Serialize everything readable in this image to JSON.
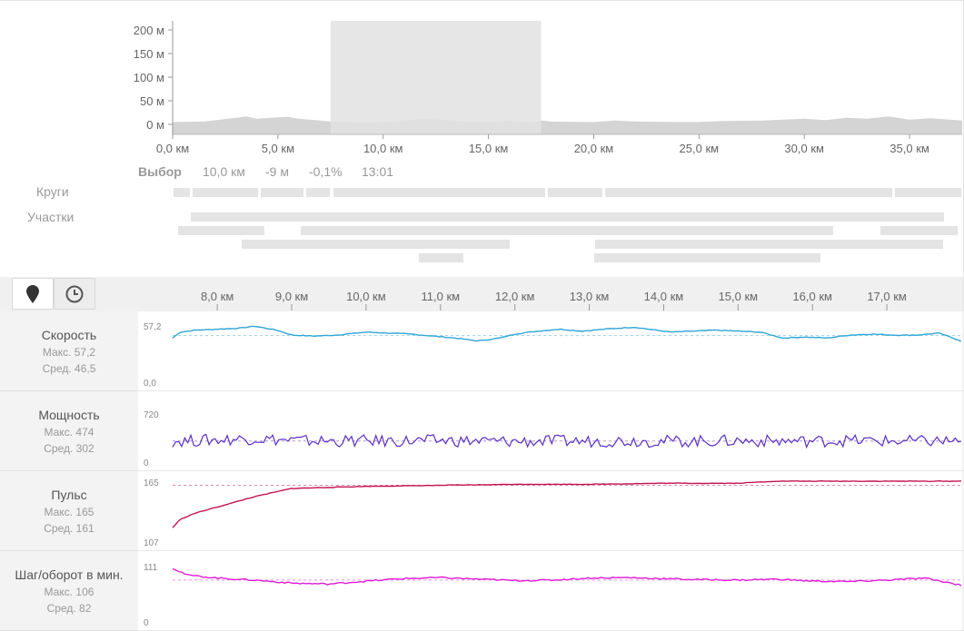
{
  "elevation": {
    "y_ticks": [
      "200 м",
      "150 м",
      "100 м",
      "50 м",
      "0 м"
    ],
    "x_ticks": [
      "0,0 км",
      "5,0 км",
      "10,0 км",
      "15,0 км",
      "20,0 км",
      "25,0 км",
      "30,0 км",
      "35,0 км"
    ],
    "selection_km": [
      7.5,
      17.5
    ]
  },
  "selection": {
    "label": "Выбор",
    "distance": "10,0 км",
    "elevation": "-9 м",
    "grade": "-0,1%",
    "time": "13:01"
  },
  "rows": {
    "laps_label": "Круги",
    "segments_label": "Участки"
  },
  "toolbar": {
    "distance_icon": "map-pin-icon",
    "time_icon": "clock-icon"
  },
  "zoom_axis": {
    "x_ticks": [
      "8,0 км",
      "9,0 км",
      "10,0 км",
      "11,0 км",
      "12,0 км",
      "13,0 км",
      "14,0 км",
      "15,0 км",
      "16,0 км",
      "17,0 км"
    ]
  },
  "streams": [
    {
      "name": "Скорость",
      "max": "Макс. 57,2",
      "avg": "Сред. 46,5",
      "top_label": "57,2",
      "bottom_label": "0,0",
      "color": "#2fa6d6"
    },
    {
      "name": "Мощность",
      "max": "Макс. 474",
      "avg": "Сред. 302",
      "top_label": "720",
      "bottom_label": "0",
      "color": "#5c2fc2"
    },
    {
      "name": "Пульс",
      "max": "Макс. 165",
      "avg": "Сред. 161",
      "top_label": "165",
      "bottom_label": "107",
      "color": "#c4134f"
    },
    {
      "name": "Шаг/оборот в мин.",
      "max": "Макс. 106",
      "avg": "Сред. 82",
      "top_label": "111",
      "bottom_label": "0",
      "color": "#e01ad6"
    }
  ],
  "chart_data": [
    {
      "type": "area",
      "ylim": [
        0,
        200
      ],
      "xlim": [
        0,
        37.5
      ],
      "x": [
        0,
        1.5,
        3,
        3.5,
        4,
        5,
        5.5,
        6,
        7,
        7.5,
        9,
        10,
        11,
        12,
        13,
        14,
        15,
        16,
        17,
        17.5,
        18,
        20,
        21,
        22,
        24,
        25,
        26,
        28,
        29,
        30,
        31,
        32,
        33,
        34,
        35,
        36,
        37.5
      ],
      "y": [
        5,
        6,
        14,
        17,
        12,
        15,
        16,
        12,
        8,
        6,
        4,
        5,
        8,
        12,
        9,
        6,
        5,
        8,
        4,
        8,
        6,
        5,
        8,
        6,
        5,
        5,
        7,
        8,
        10,
        12,
        9,
        14,
        12,
        17,
        10,
        13,
        8
      ],
      "yunit": "м"
    },
    {
      "type": "line",
      "name": "Скорость",
      "xlim": [
        7.4,
        18.0
      ],
      "ylim": [
        0,
        57.2
      ],
      "avg": 46.5,
      "x": [
        7.4,
        7.5,
        7.7,
        8.0,
        8.3,
        8.5,
        8.8,
        9.0,
        9.3,
        9.6,
        10.0,
        10.3,
        10.6,
        10.9,
        11.2,
        11.5,
        11.8,
        12.0,
        12.3,
        12.6,
        12.9,
        13.2,
        13.6,
        13.9,
        14.1,
        14.4,
        14.7,
        15.0,
        15.3,
        15.6,
        15.9,
        16.2,
        16.5,
        16.8,
        17.1,
        17.4,
        17.7,
        18.0
      ],
      "y": [
        44,
        50,
        52,
        53,
        54,
        56,
        52,
        47,
        46,
        47,
        50,
        49,
        48,
        46,
        44,
        41,
        44,
        48,
        51,
        53,
        51,
        53,
        55,
        52,
        50,
        51,
        52,
        51,
        50,
        44,
        45,
        44,
        47,
        48,
        47,
        47,
        49,
        41
      ]
    },
    {
      "type": "line",
      "name": "Мощность",
      "xlim": [
        7.4,
        18.0
      ],
      "ylim": [
        0,
        720
      ],
      "avg": 302,
      "x": [
        7.4,
        8.0,
        8.5,
        9.0,
        9.5,
        10.0,
        10.5,
        11.0,
        11.5,
        12.0,
        12.5,
        13.0,
        13.5,
        14.0,
        14.5,
        15.0,
        15.5,
        16.0,
        16.5,
        17.0,
        17.5,
        18.0
      ],
      "y": [
        300,
        320,
        340,
        310,
        300,
        305,
        300,
        310,
        300,
        295,
        300,
        300,
        305,
        300,
        300,
        305,
        300,
        300,
        310,
        300,
        300,
        305
      ]
    },
    {
      "type": "line",
      "name": "Пульс",
      "xlim": [
        7.4,
        18.0
      ],
      "ylim": [
        107,
        165
      ],
      "avg": 161,
      "x": [
        7.4,
        7.5,
        7.7,
        8.0,
        8.5,
        9.0,
        10.0,
        11.0,
        12.0,
        13.0,
        14.0,
        15.0,
        15.5,
        16.0,
        17.0,
        18.0
      ],
      "y": [
        120,
        128,
        134,
        140,
        150,
        158,
        160,
        161,
        162,
        162,
        163,
        163,
        165,
        165,
        165,
        165
      ]
    },
    {
      "type": "line",
      "name": "Шаг/оборот в мин.",
      "xlim": [
        7.4,
        18.0
      ],
      "ylim": [
        0,
        111
      ],
      "avg": 82,
      "x": [
        7.4,
        7.6,
        8.0,
        8.5,
        9.0,
        9.5,
        10.0,
        10.5,
        11.0,
        11.5,
        12.0,
        12.5,
        13.0,
        13.5,
        14.0,
        14.5,
        15.0,
        15.5,
        16.0,
        16.5,
        17.0,
        17.5,
        18.0
      ],
      "y": [
        106,
        92,
        86,
        82,
        76,
        74,
        80,
        85,
        87,
        84,
        81,
        82,
        86,
        87,
        85,
        83,
        82,
        84,
        80,
        79,
        82,
        86,
        72
      ]
    }
  ]
}
